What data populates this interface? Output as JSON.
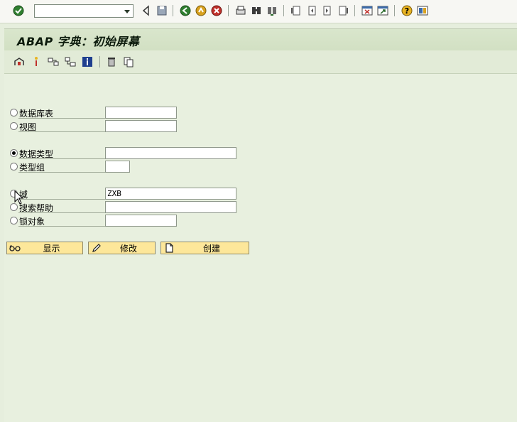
{
  "toolbar": {
    "command_field_value": "",
    "icons": [
      "enter-icon",
      "back-icon",
      "save-icon",
      "exit-icon",
      "cancel-icon",
      "print-icon",
      "find-icon",
      "find-next-icon",
      "first-page-icon",
      "prev-page-icon",
      "next-page-icon",
      "last-page-icon",
      "new-session-icon",
      "shortcut-icon",
      "help-icon",
      "layout-icon"
    ]
  },
  "screen": {
    "title": "ABAP 字典：初始屏幕"
  },
  "app_toolbar": {
    "icons": [
      "object-list-icon",
      "where-used-icon",
      "other-object-icon",
      "display-navigation-icon",
      "info-icon",
      "delete-icon",
      "copy-icon"
    ]
  },
  "options": [
    {
      "label": "数据库表",
      "value": "",
      "selected": false
    },
    {
      "label": "视图",
      "value": "",
      "selected": false
    },
    {
      "label": "数据类型",
      "value": "",
      "selected": true
    },
    {
      "label": "类型组",
      "value": "",
      "selected": false
    },
    {
      "label": "域",
      "value": "ZXB",
      "selected": false
    },
    {
      "label": "搜索帮助",
      "value": "",
      "selected": false
    },
    {
      "label": "锁对象",
      "value": "",
      "selected": false
    }
  ],
  "buttons": {
    "display": "显示",
    "change": "修改",
    "create": "创建"
  },
  "colors": {
    "background": "#e6eedd",
    "button": "#fde79a",
    "title_bar": "#d5e2c7"
  }
}
